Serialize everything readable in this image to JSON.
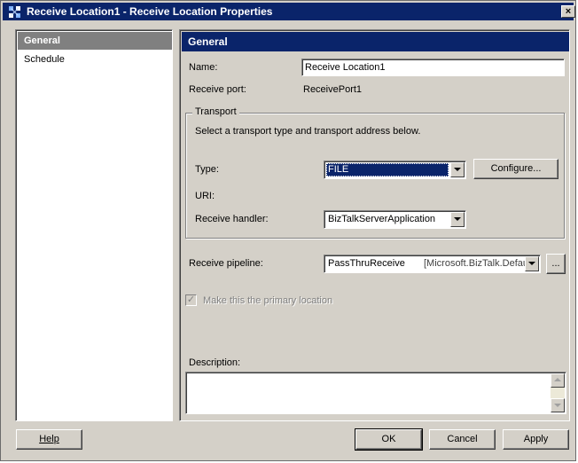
{
  "window": {
    "title": "Receive Location1 - Receive Location Properties",
    "close_glyph": "×"
  },
  "nav": {
    "items": [
      {
        "label": "General",
        "selected": true
      },
      {
        "label": "Schedule",
        "selected": false
      }
    ]
  },
  "general": {
    "header": "General",
    "name_label": "Name:",
    "name_value": "Receive Location1",
    "receive_port_label": "Receive port:",
    "receive_port_value": "ReceivePort1",
    "transport": {
      "legend": "Transport",
      "instructions": "Select a transport type and transport address below.",
      "type_label": "Type:",
      "type_value": "FILE",
      "configure_label": "Configure...",
      "uri_label": "URI:",
      "handler_label": "Receive handler:",
      "handler_value": "BizTalkServerApplication"
    },
    "pipeline_label": "Receive pipeline:",
    "pipeline_name": "PassThruReceive",
    "pipeline_assembly": "[Microsoft.BizTalk.Defau",
    "pipeline_browse_label": "...",
    "primary_location_label": "Make this the primary location",
    "primary_location_checked": true,
    "description_label": "Description:",
    "description_value": ""
  },
  "buttons": {
    "help": "Help",
    "ok": "OK",
    "cancel": "Cancel",
    "apply": "Apply"
  },
  "colors": {
    "titlebar": "#0a246a",
    "face": "#d4d0c8",
    "selection": "#0a246a",
    "nav_selected": "#808080"
  }
}
